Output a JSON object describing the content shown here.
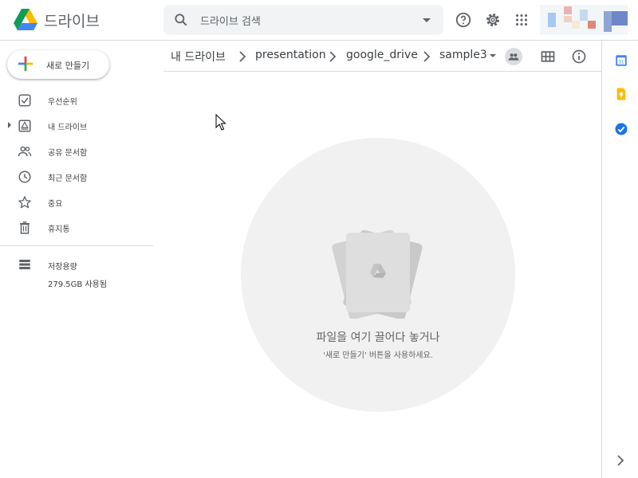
{
  "app": {
    "name": "드라이브"
  },
  "search": {
    "placeholder": "드라이브 검색"
  },
  "sidebar": {
    "new_label": "새로 만들기",
    "items": [
      {
        "label": "우선순위",
        "icon": "priority-icon"
      },
      {
        "label": "내 드라이브",
        "icon": "my-drive-icon"
      },
      {
        "label": "공유 문서함",
        "icon": "shared-icon"
      },
      {
        "label": "최근 문서함",
        "icon": "clock-icon"
      },
      {
        "label": "중요",
        "icon": "star-icon"
      },
      {
        "label": "휴지통",
        "icon": "trash-icon"
      }
    ],
    "storage_label": "저장용량",
    "storage_used": "279.5GB 사용됨"
  },
  "breadcrumb": [
    "내 드라이브",
    "presentation",
    "google_drive",
    "sample3"
  ],
  "empty": {
    "title": "파일을 여기 끌어다 놓거나",
    "subtitle": "'새로 만들기' 버튼을 사용하세요."
  },
  "colors": {
    "drive_blue": "#4285f4",
    "drive_green": "#0f9d58",
    "drive_yellow": "#f4b400",
    "drive_red": "#db4437",
    "tasks_blue": "#1a73e8"
  }
}
